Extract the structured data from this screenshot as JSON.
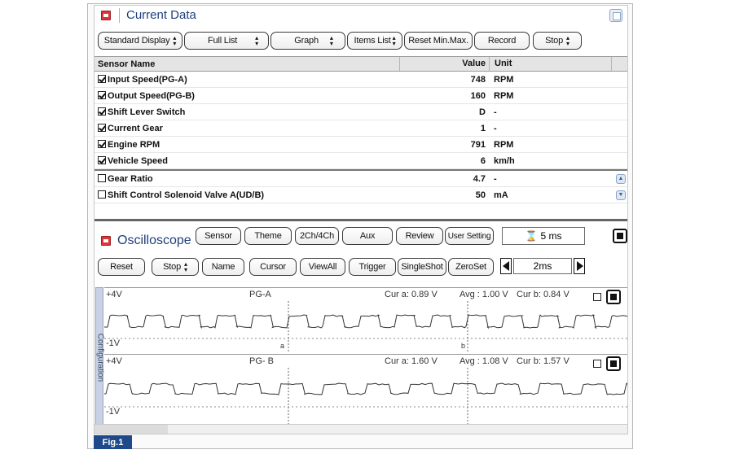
{
  "current_data": {
    "title": "Current Data",
    "toolbar": [
      {
        "id": "standard-display",
        "label": "Standard Display",
        "spin": true
      },
      {
        "id": "full-list",
        "label": "Full List",
        "spin": true
      },
      {
        "id": "graph",
        "label": "Graph",
        "spin": true
      },
      {
        "id": "items-list",
        "label": "Items List",
        "spin": true
      },
      {
        "id": "reset-minmax",
        "label": "Reset Min.Max.",
        "spin": false
      },
      {
        "id": "record",
        "label": "Record",
        "spin": false
      },
      {
        "id": "stop",
        "label": "Stop",
        "spin": true
      }
    ],
    "table": {
      "headers": {
        "name": "Sensor Name",
        "value": "Value",
        "unit": "Unit"
      },
      "rows": [
        {
          "checked": true,
          "name": "Input Speed(PG-A)",
          "value": "748",
          "unit": "RPM"
        },
        {
          "checked": true,
          "name": "Output Speed(PG-B)",
          "value": "160",
          "unit": "RPM"
        },
        {
          "checked": true,
          "name": "Shift Lever Switch",
          "value": "D",
          "unit": "-"
        },
        {
          "checked": true,
          "name": "Current Gear",
          "value": "1",
          "unit": "-"
        },
        {
          "checked": true,
          "name": "Engine RPM",
          "value": "791",
          "unit": "RPM"
        },
        {
          "checked": true,
          "name": "Vehicle Speed",
          "value": "6",
          "unit": "km/h"
        }
      ],
      "extra_rows": [
        {
          "checked": false,
          "name": "Gear Ratio",
          "value": "4.7",
          "unit": "-"
        },
        {
          "checked": false,
          "name": "Shift Control Solenoid Valve A(UD/B)",
          "value": "50",
          "unit": "mA"
        }
      ]
    }
  },
  "oscilloscope": {
    "title": "Oscilloscope",
    "row1": [
      "Sensor",
      "Theme",
      "2Ch/4Ch",
      "Aux",
      "Review",
      "User Setting"
    ],
    "time_display": "5 ms",
    "row2": [
      {
        "label": "Reset",
        "spin": false
      },
      {
        "label": "Stop",
        "spin": true
      },
      {
        "label": "Name",
        "spin": false
      },
      {
        "label": "Cursor",
        "spin": false
      },
      {
        "label": "ViewAll",
        "spin": false
      },
      {
        "label": "Trigger",
        "spin": false
      },
      {
        "label": "SingleShot",
        "spin": false
      },
      {
        "label": "ZeroSet",
        "spin": false
      }
    ],
    "time_scale": "2ms",
    "side_tab": "Configuration",
    "channels": [
      {
        "top": "+4V",
        "bottom": "-1V",
        "name": "PG-A",
        "cur_a": "Cur a: 0.89 V",
        "avg": "Avg : 1.00 V",
        "cur_b": "Cur b: 0.84 V",
        "marker_a": "a",
        "marker_b": "b"
      },
      {
        "top": "+4V",
        "bottom": "-1V",
        "name": "PG- B",
        "cur_a": "Cur a: 1.60 V",
        "avg": "Avg : 1.08 V",
        "cur_b": "Cur b: 1.57 V"
      }
    ]
  },
  "figure_label": "Fig.1",
  "colors": {
    "title": "#1f3f7a",
    "red_icon": "#d9363e",
    "fig_bg": "#1e4a8a"
  }
}
